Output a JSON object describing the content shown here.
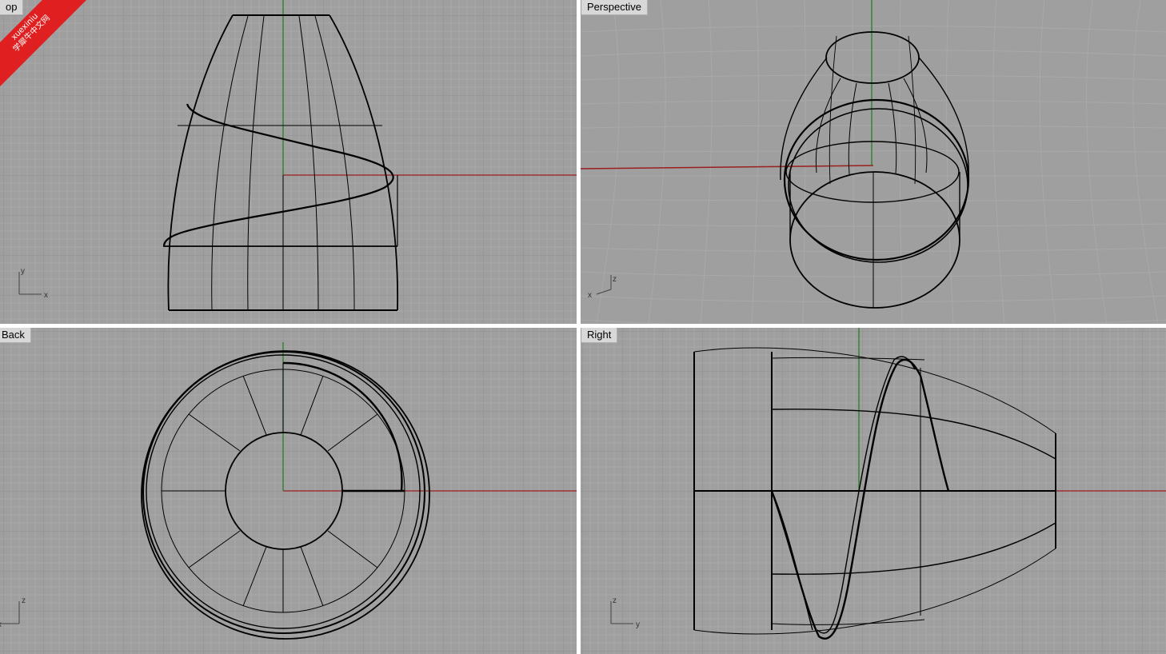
{
  "watermark": {
    "line1": "xuexiniu",
    "line2": "学犀牛中文网"
  },
  "colors": {
    "background": "#9f9f9f",
    "grid_minor": "#a8a8a8",
    "grid_major": "#8f8f8f",
    "x_axis": "#9a1e1e",
    "y_axis": "#1e7a1e",
    "curve": "#000000",
    "label_bg": "#d8d8d8",
    "watermark": "#e02020"
  },
  "viewports": {
    "top": {
      "label": "op",
      "axis_a": "y",
      "axis_b": "x"
    },
    "persp": {
      "label": "Perspective",
      "axis_a": "z",
      "axis_b": "x"
    },
    "back": {
      "label": "Back",
      "axis_a": "z",
      "axis_b": "x"
    },
    "right": {
      "label": "Right",
      "axis_a": "z",
      "axis_b": "y"
    }
  }
}
